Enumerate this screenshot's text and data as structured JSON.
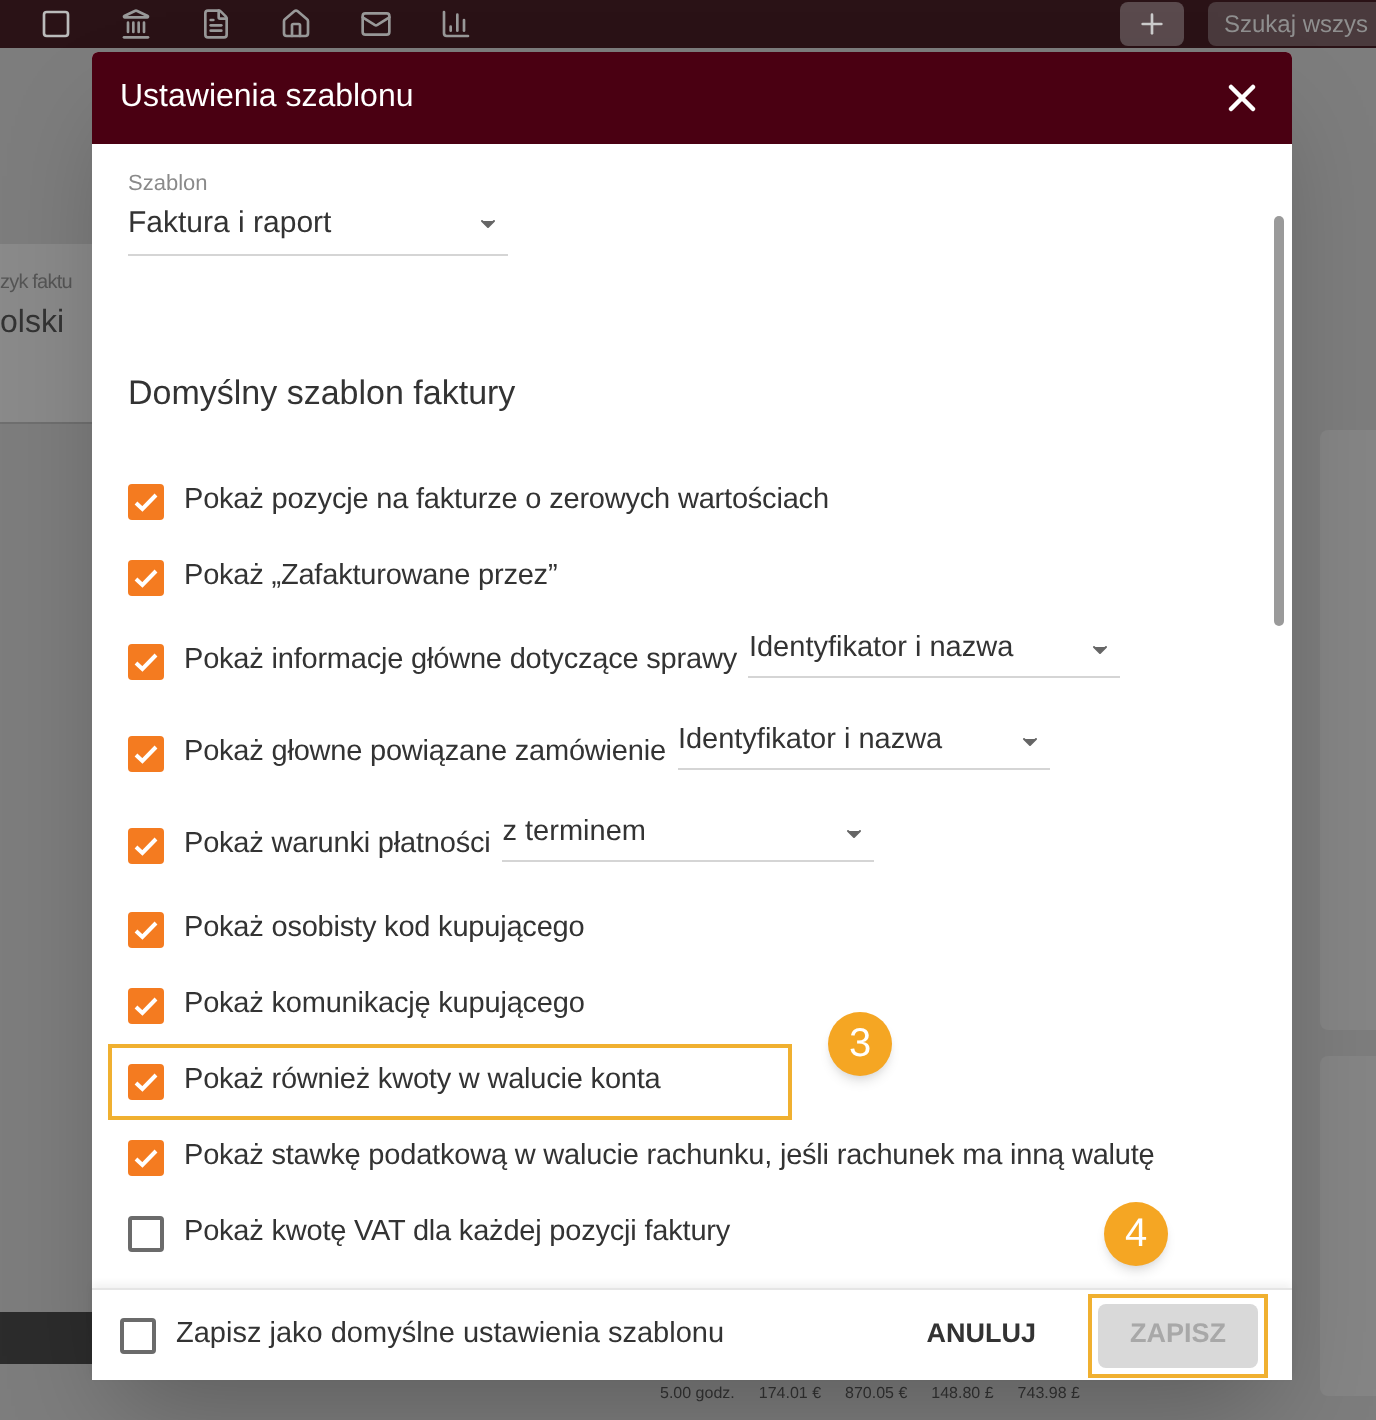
{
  "background": {
    "search": {
      "placeholder": "Szukaj wszys"
    },
    "field_label": "zyk faktu",
    "field_value": "olski",
    "table_cells": [
      "5.00 godz.",
      "174.01 €",
      "870.05 €",
      "148.80 £",
      "743.98 £"
    ]
  },
  "dialog": {
    "title": "Ustawienia szablonu",
    "template": {
      "label": "Szablon",
      "value": "Faktura i raport"
    },
    "heading": "Domyślny szablon faktury",
    "options": [
      {
        "kind": "checkbox",
        "label": "Pokaż pozycje na fakturze o zerowych wartościach",
        "checked": true
      },
      {
        "kind": "checkbox",
        "label": "Pokaż „Zafakturowane przez”",
        "checked": true
      },
      {
        "kind": "select",
        "label": "Pokaż informacje główne dotyczące sprawy",
        "checked": true,
        "value": "Identyfikator i nazwa"
      },
      {
        "kind": "select",
        "label": "Pokaż głowne powiązane zamówienie",
        "checked": true,
        "value": "Identyfikator i nazwa"
      },
      {
        "kind": "select",
        "label": "Pokaż warunki płatności",
        "checked": true,
        "value": "z terminem"
      },
      {
        "kind": "checkbox",
        "label": "Pokaż osobisty kod kupującego",
        "checked": true
      },
      {
        "kind": "checkbox",
        "label": "Pokaż komunikację kupującego",
        "checked": true
      },
      {
        "kind": "checkbox",
        "label": "Pokaż również kwoty w walucie konta",
        "checked": true,
        "callout": "3"
      },
      {
        "kind": "checkbox",
        "label": "Pokaż stawkę podatkową w walucie rachunku, jeśli rachunek ma inną walutę",
        "checked": true
      },
      {
        "kind": "checkbox",
        "label": "Pokaż kwotę VAT dla każdej pozycji faktury",
        "checked": false
      }
    ],
    "footer": {
      "default_label": "Zapisz jako domyślne ustawienia szablonu",
      "default_checked": false,
      "cancel": "ANULUJ",
      "save": "ZAPISZ",
      "save_disabled": true,
      "save_callout": "4"
    }
  }
}
